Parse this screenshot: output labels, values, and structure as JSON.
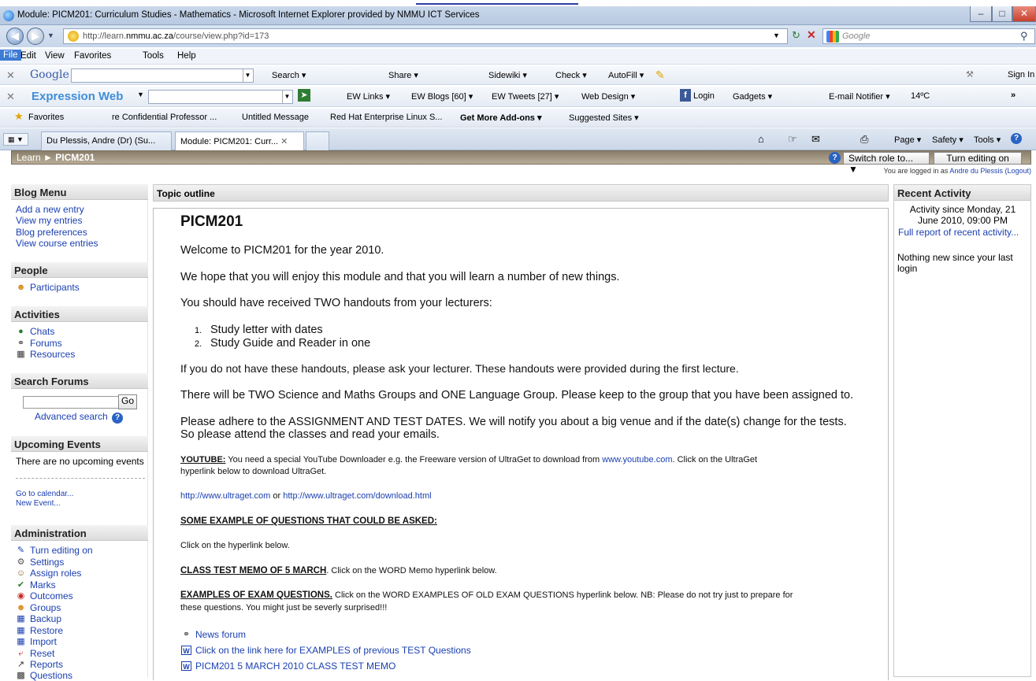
{
  "window": {
    "title": "Module: PICM201: Curriculum Studies - Mathematics - Microsoft Internet Explorer provided by NMMU ICT Services",
    "controls": [
      "–",
      "□",
      "✕"
    ]
  },
  "address": {
    "url_prefix": "http://learn.",
    "url_domain": "nmmu.ac.za",
    "url_path": "/course/view.php?id=173",
    "search_placeholder": "Google"
  },
  "menu": [
    "File",
    "Edit",
    "View",
    "Favorites",
    "Tools",
    "Help"
  ],
  "google_toolbar": {
    "brand": "Google",
    "items": [
      "Search ▾",
      "Share ▾",
      "Sidewiki ▾",
      "Check ▾",
      "AutoFill ▾"
    ],
    "right": "Sign In"
  },
  "expression_toolbar": {
    "brand": "Expression Web",
    "items": [
      "EW Links ▾",
      "EW Blogs [60] ▾",
      "EW Tweets  [27] ▾",
      "Web Design ▾",
      "Login",
      "Gadgets ▾",
      "E-mail Notifier ▾",
      "14ºC"
    ]
  },
  "favorites_bar": {
    "label": "Favorites",
    "items": [
      "re Confidential Professor ...",
      "Untitled Message",
      "Red Hat Enterprise Linux S...",
      "Get More Add-ons ▾",
      "Suggested Sites ▾"
    ]
  },
  "tabs": {
    "items": [
      "Du Plessis, Andre (Dr) (Su...",
      "Module: PICM201: Curr..."
    ],
    "commands": [
      "Page ▾",
      "Safety ▾",
      "Tools ▾"
    ]
  },
  "page": {
    "breadcrumb_root": "Learn",
    "breadcrumb_sep": "►",
    "breadcrumb_course": "PICM201",
    "switch_role": "Switch role to...",
    "turn_editing": "Turn editing on",
    "logged_in_prefix": "You are logged in as",
    "logged_in_user": "Andre du Plessis",
    "logout": "(Logout)"
  },
  "left": {
    "blog_menu": {
      "title": "Blog Menu",
      "items": [
        "Add a new entry",
        "View my entries",
        "Blog preferences",
        "View course entries"
      ]
    },
    "people": {
      "title": "People",
      "items": [
        "Participants"
      ]
    },
    "activities": {
      "title": "Activities",
      "items": [
        "Chats",
        "Forums",
        "Resources"
      ]
    },
    "search_forums": {
      "title": "Search Forums",
      "go": "Go",
      "advanced": "Advanced search"
    },
    "upcoming": {
      "title": "Upcoming Events",
      "text": "There are no upcoming events",
      "links": [
        "Go to calendar...",
        "New Event..."
      ]
    },
    "administration": {
      "title": "Administration",
      "items": [
        "Turn editing on",
        "Settings",
        "Assign roles",
        "Marks",
        "Outcomes",
        "Groups",
        "Backup",
        "Restore",
        "Import",
        "Reset",
        "Reports",
        "Questions"
      ]
    }
  },
  "center": {
    "header": "Topic outline",
    "title": "PICM201",
    "welcome": "Welcome to PICM201 for the year 2010.",
    "hope": "We hope that you will enjoy this module and that you will learn a number of new things.",
    "handouts_intro": "You should have received TWO handouts from your lecturers:",
    "handouts": [
      "Study letter with dates",
      "Study Guide and Reader in one"
    ],
    "no_handouts": "If you do not have these handouts, please ask your lecturer. These handouts were provided during the first lecture.",
    "groups": "There will be TWO Science and Maths Groups and ONE Language Group. Please keep to the group that you have been assigned to.",
    "dates_1": "Please adhere to the ASSIGNMENT AND TEST DATES. We will notify you about a big venue and if the date(s) change for the tests.",
    "dates_2": "So please attend the classes and read your emails.",
    "youtube_label": "YOUTUBE:",
    "youtube_text_1": " You need a special YouTube Downloader e.g. the Freeware version of UltraGet to download from ",
    "youtube_link": "www.youtube.com",
    "youtube_text_2": ". Click on the UltraGet",
    "youtube_text_3": "hyperlink below to download UltraGet.",
    "ultraget_link_1": "http://www.ultraget.com",
    "ultraget_or": " or ",
    "ultraget_link_2": "http://www.ultraget.com/download.html",
    "examples_heading": "SOME EXAMPLE OF QUESTIONS THAT COULD BE ASKED:",
    "click_below": "Click on the hyperlink below.",
    "memo_label": "CLASS TEST MEMO OF 5 MARCH",
    "memo_text": ". Click on the WORD Memo hyperlink below.",
    "exam_label": "EXAMPLES OF EXAM QUESTIONS.",
    "exam_text_1": " Click on the WORD EXAMPLES OF OLD EXAM QUESTIONS hyperlink below. NB: Please do not try just to prepare for",
    "exam_text_2": "these questions. You might just be severly surprised!!!",
    "resources": [
      "News forum",
      "Click on the link here for EXAMPLES of previous TEST Questions",
      "PICM201 5 MARCH 2010 CLASS TEST MEMO"
    ]
  },
  "right": {
    "title": "Recent Activity",
    "since_1": "Activity since Monday, 21",
    "since_2": "June 2010, 09:00 PM",
    "full_report": "Full report of recent activity...",
    "nothing": "Nothing new since your last login"
  }
}
